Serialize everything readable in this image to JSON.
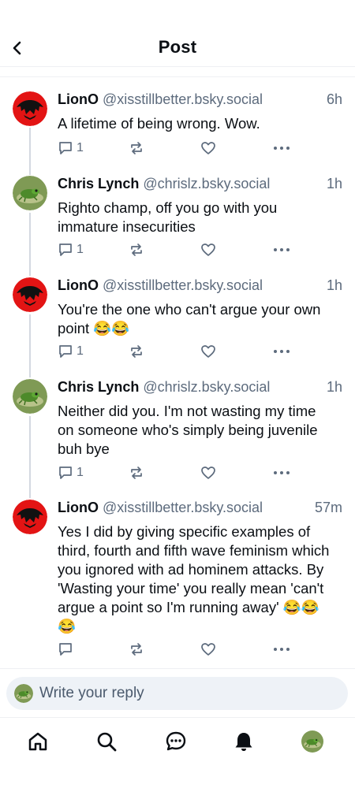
{
  "header": {
    "title": "Post",
    "back_icon": "chevron-left-icon"
  },
  "posts": [
    {
      "name": "LionO",
      "handle": "@xisstillbetter.bsky.social",
      "time": "6h",
      "text": "A lifetime of being wrong. Wow.",
      "replies": "1"
    },
    {
      "name": "Chris Lynch",
      "handle": "@chrislz.bsky.social",
      "time": "1h",
      "text": "Righto champ, off you go with you immature insecurities",
      "replies": "1"
    },
    {
      "name": "LionO",
      "handle": "@xisstillbetter.bsky.social",
      "time": "1h",
      "text": "You're the one who can't argue your own point 😂😂",
      "replies": "1"
    },
    {
      "name": "Chris Lynch",
      "handle": "@chrislz.bsky.social",
      "time": "1h",
      "text": "Neither did you. I'm not wasting my time on someone who's simply being juvenile buh bye",
      "replies": "1"
    },
    {
      "name": "LionO",
      "handle": "@xisstillbetter.bsky.social",
      "time": "57m",
      "text": "Yes I did by giving specific examples of third, fourth and  fifth wave feminism which you ignored with ad hominem attacks. By 'Wasting your time' you really mean 'can't argue a point so I'm running away' 😂😂😂",
      "replies": ""
    }
  ],
  "reply": {
    "placeholder": "Write your reply"
  },
  "tabs": [
    {
      "icon": "home-icon"
    },
    {
      "icon": "search-icon"
    },
    {
      "icon": "chat-icon"
    },
    {
      "icon": "bell-icon"
    },
    {
      "icon": "profile-avatar"
    }
  ],
  "colors": {
    "text": "#0b0f14",
    "muted": "#5d6b7d",
    "thread_line": "#d4d9e1",
    "input_bg": "#eef2f7"
  }
}
